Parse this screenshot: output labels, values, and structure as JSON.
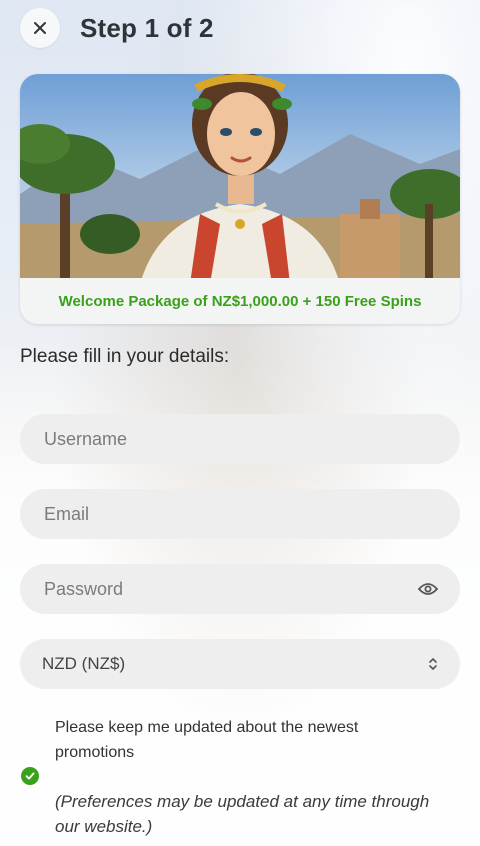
{
  "header": {
    "close_icon": "close-icon",
    "title": "Step 1 of 2"
  },
  "banner": {
    "promo_text": "Welcome Package of NZ$1,000.00 + 150 Free Spins",
    "promo_color": "#3aa11a"
  },
  "form": {
    "intro": "Please fill in your details:",
    "username": {
      "placeholder": "Username",
      "value": ""
    },
    "email": {
      "placeholder": "Email",
      "value": ""
    },
    "password": {
      "placeholder": "Password",
      "value": "",
      "icon": "eye-icon"
    },
    "currency": {
      "selected": "NZD (NZ$)",
      "icon": "chevron-up-down-icon"
    }
  },
  "consent": {
    "checked": true,
    "label": "Please keep me updated about the newest promotions",
    "note": "(Preferences may be updated at any time through our website.)",
    "check_color": "#3aa11a"
  }
}
